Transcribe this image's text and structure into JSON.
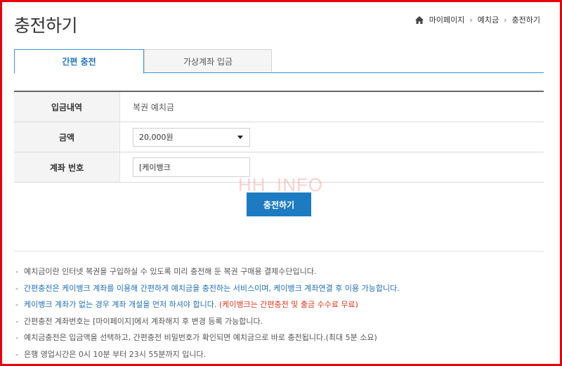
{
  "page": {
    "title": "충전하기"
  },
  "breadcrumb": {
    "items": [
      "마이페이지",
      "예치금",
      "충전하기"
    ]
  },
  "tabs": [
    {
      "label": "간편 충전",
      "active": true
    },
    {
      "label": "가상계좌 입금",
      "active": false
    }
  ],
  "form": {
    "rows": [
      {
        "label": "입금내역",
        "value": "복권 예치금"
      },
      {
        "label": "금액",
        "value": "20,000원"
      },
      {
        "label": "계좌 번호",
        "value": "[케이뱅크"
      }
    ]
  },
  "watermark": "HH_INFO",
  "charge_button": "충전하기",
  "notes": [
    "예치금이란 인터넷 복권을 구입하실 수 있도록 미리 충전해 둔 복권 구매용 결제수단입니다.",
    "간편충전은 케이뱅크 계좌를 이용해 간편하게 예치금을 충전하는 서비스이며, 케이뱅크 계좌연결 후 이용 가능합니다.",
    "케이뱅크 계좌가 없는 경우 계좌 개설을 먼저 하셔야 합니다.",
    "(케이뱅크는 간편충전 및 출금 수수료 무료)",
    "간편충전 계좌번호는 [마이페이지]에서 계좌해지 후 변경 등록 가능합니다.",
    "예치금충전은 입금액을 선택하고, 간편충전 비밀번호가 확인되면 예치금으로 바로 충전됩니다.(최대 5분 소요)",
    "은행 영업시간은 0시 10분 부터 23시 55분까지 입니다."
  ],
  "colors": {
    "accent": "#1d7cc1",
    "frame": "#e8000b",
    "warning": "#d9391c"
  }
}
